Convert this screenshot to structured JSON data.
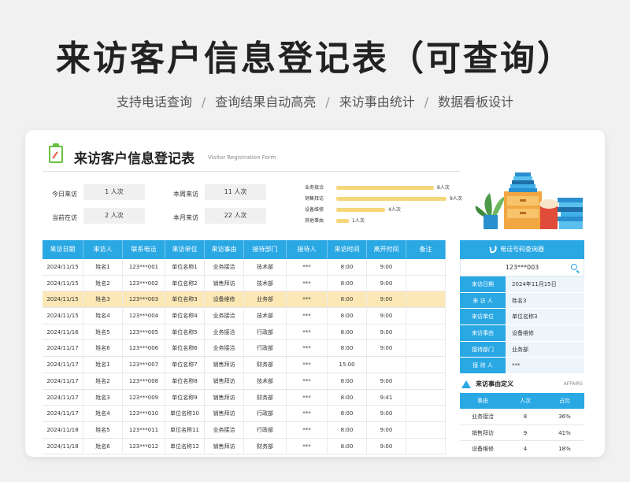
{
  "page": {
    "title": "来访客户信息登记表（可查询）",
    "features": [
      "支持电话查询",
      "查询结果自动高亮",
      "来访事由统计",
      "数据看板设计"
    ],
    "separator": "/"
  },
  "card": {
    "title": "来访客户信息登记表",
    "title_en": "Visitor Registration Form"
  },
  "stats": {
    "today_label": "今日来访",
    "today_value": "1 人次",
    "week_label": "本周来访",
    "week_value": "11 人次",
    "current_label": "当前在访",
    "current_value": "2 人次",
    "month_label": "本月来访",
    "month_value": "22 人次"
  },
  "reason_stats": [
    {
      "label": "业务接洽",
      "value": 8,
      "text": "8人次"
    },
    {
      "label": "销售拜访",
      "value": 9,
      "text": "9人次"
    },
    {
      "label": "设备维修",
      "value": 4,
      "text": "4人次"
    },
    {
      "label": "其他事由",
      "value": 1,
      "text": "1人次"
    }
  ],
  "reason_max": 9,
  "table": {
    "headers": [
      "来访日期",
      "来访人",
      "联系电话",
      "来访单位",
      "来访事由",
      "接待部门",
      "接待人",
      "来访时间",
      "离开时间",
      "备注"
    ],
    "highlight_row": 2,
    "rows": [
      [
        "2024/11/15",
        "姓名1",
        "123***001",
        "单位名称1",
        "业务接洽",
        "技术部",
        "***",
        "8:00",
        "9:00",
        ""
      ],
      [
        "2024/11/15",
        "姓名2",
        "123***002",
        "单位名称2",
        "销售拜访",
        "技术部",
        "***",
        "8:00",
        "9:00",
        ""
      ],
      [
        "2024/11/15",
        "姓名3",
        "123***003",
        "单位名称3",
        "设备维修",
        "业务部",
        "***",
        "8:00",
        "9:00",
        ""
      ],
      [
        "2024/11/15",
        "姓名4",
        "123***004",
        "单位名称4",
        "业务接洽",
        "技术部",
        "***",
        "8:00",
        "9:00",
        ""
      ],
      [
        "2024/11/16",
        "姓名5",
        "123***005",
        "单位名称5",
        "业务接洽",
        "行政部",
        "***",
        "8:00",
        "9:00",
        ""
      ],
      [
        "2024/11/17",
        "姓名6",
        "123***006",
        "单位名称6",
        "业务接洽",
        "行政部",
        "***",
        "8:00",
        "9:00",
        ""
      ],
      [
        "2024/11/17",
        "姓名1",
        "123***007",
        "单位名称7",
        "销售拜访",
        "财务部",
        "***",
        "15:00",
        "",
        ""
      ],
      [
        "2024/11/17",
        "姓名2",
        "123***008",
        "单位名称8",
        "销售拜访",
        "技术部",
        "***",
        "8:00",
        "9:00",
        ""
      ],
      [
        "2024/11/17",
        "姓名3",
        "123***009",
        "单位名称9",
        "销售拜访",
        "财务部",
        "***",
        "8:00",
        "9:41",
        ""
      ],
      [
        "2024/11/17",
        "姓名4",
        "123***010",
        "单位名称10",
        "销售拜访",
        "行政部",
        "***",
        "8:00",
        "9:00",
        ""
      ],
      [
        "2024/11/18",
        "姓名5",
        "123***011",
        "单位名称11",
        "业务接洽",
        "行政部",
        "***",
        "8:00",
        "9:00",
        ""
      ],
      [
        "2024/11/18",
        "姓名6",
        "123***012",
        "单位名称12",
        "销售拜访",
        "财务部",
        "***",
        "8:00",
        "9:00",
        ""
      ]
    ]
  },
  "query": {
    "header": "电话号码查询器",
    "search_value": "123***003",
    "fields": [
      {
        "key": "来访日期",
        "value": "2024年11月15日"
      },
      {
        "key": "来 访 人",
        "value": "姓名3"
      },
      {
        "key": "来访单位",
        "value": "单位名称3"
      },
      {
        "key": "来访事由",
        "value": "设备维修"
      },
      {
        "key": "接待部门",
        "value": "业务部"
      },
      {
        "key": "接 待 人",
        "value": "***"
      }
    ]
  },
  "definition": {
    "title": "来访事由定义",
    "title_en": "AFFAIRS",
    "headers": [
      "事由",
      "人次",
      "占比"
    ],
    "rows": [
      [
        "业务接洽",
        "8",
        "36%"
      ],
      [
        "销售拜访",
        "9",
        "41%"
      ],
      [
        "设备维修",
        "4",
        "18%"
      ]
    ]
  },
  "colors": {
    "primary": "#2aa8e4",
    "highlight": "#fbe8b6",
    "bar": "#f5d77a"
  }
}
